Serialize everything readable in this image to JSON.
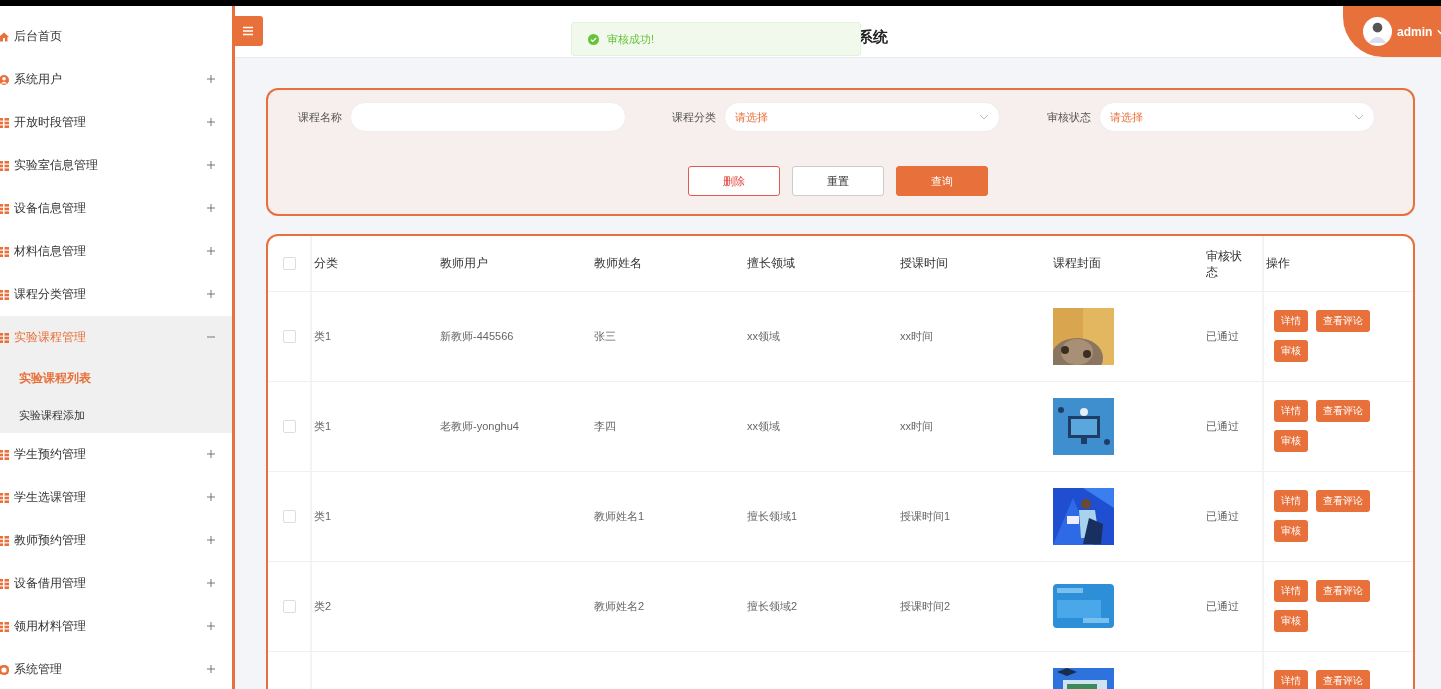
{
  "sidebar": {
    "items": [
      {
        "label": "后台首页",
        "kind": "home",
        "expandable": false,
        "expanded": false
      },
      {
        "label": "系统用户",
        "kind": "user",
        "expandable": true,
        "expanded": false
      },
      {
        "label": "开放时段管理",
        "kind": "grid",
        "expandable": true,
        "expanded": false
      },
      {
        "label": "实验室信息管理",
        "kind": "grid",
        "expandable": true,
        "expanded": false
      },
      {
        "label": "设备信息管理",
        "kind": "grid",
        "expandable": true,
        "expanded": false
      },
      {
        "label": "材料信息管理",
        "kind": "grid",
        "expandable": true,
        "expanded": false
      },
      {
        "label": "课程分类管理",
        "kind": "grid",
        "expandable": true,
        "expanded": false
      },
      {
        "label": "实验课程管理",
        "kind": "grid",
        "expandable": true,
        "expanded": true,
        "children": [
          {
            "label": "实验课程列表",
            "selected": true
          },
          {
            "label": "实验课程添加",
            "selected": false
          }
        ]
      },
      {
        "label": "学生预约管理",
        "kind": "grid",
        "expandable": true,
        "expanded": false
      },
      {
        "label": "学生选课管理",
        "kind": "grid",
        "expandable": true,
        "expanded": false
      },
      {
        "label": "教师预约管理",
        "kind": "grid",
        "expandable": true,
        "expanded": false
      },
      {
        "label": "设备借用管理",
        "kind": "grid",
        "expandable": true,
        "expanded": false
      },
      {
        "label": "领用材料管理",
        "kind": "grid",
        "expandable": true,
        "expanded": false
      },
      {
        "label": "系统管理",
        "kind": "gear",
        "expandable": true,
        "expanded": false
      }
    ]
  },
  "header": {
    "title": "系统",
    "user": "admin"
  },
  "toast": {
    "kind": "success",
    "message": "审核成功!"
  },
  "search": {
    "fields": [
      {
        "label": "课程名称",
        "kind": "input"
      },
      {
        "label": "课程分类",
        "kind": "select",
        "placeholder": "请选择"
      },
      {
        "label": "审核状态",
        "kind": "select",
        "placeholder": "请选择"
      }
    ],
    "buttons": [
      {
        "label": "删除",
        "kind": "danger"
      },
      {
        "label": "重置",
        "kind": "plain"
      },
      {
        "label": "查询",
        "kind": "primary"
      }
    ]
  },
  "table": {
    "all_checked": false,
    "columns": [
      "分类",
      "教师用户",
      "教师姓名",
      "擅长领域",
      "授课时间",
      "课程封面",
      "审核状态",
      "操作"
    ],
    "rows": [
      {
        "checked": false,
        "category": "类1",
        "teacher_user": "新教师-445566",
        "teacher_name": "张三",
        "field": "xx领域",
        "time": "xx时间",
        "cover": {
          "kind": "picture"
        },
        "status": "已通过",
        "actions": [
          "详情",
          "查看评论",
          "审核"
        ]
      },
      {
        "checked": false,
        "category": "类1",
        "teacher_user": "老教师-yonghu4",
        "teacher_name": "李四",
        "field": "xx领域",
        "time": "xx时间",
        "cover": {
          "kind": "picture"
        },
        "status": "已通过",
        "actions": [
          "详情",
          "查看评论",
          "审核"
        ]
      },
      {
        "checked": false,
        "category": "类1",
        "teacher_user": "",
        "teacher_name": "教师姓名1",
        "field": "擅长领域1",
        "time": "授课时间1",
        "cover": {
          "kind": "picture"
        },
        "status": "已通过",
        "actions": [
          "详情",
          "查看评论",
          "审核"
        ]
      },
      {
        "checked": false,
        "category": "类2",
        "teacher_user": "",
        "teacher_name": "教师姓名2",
        "field": "擅长领域2",
        "time": "授课时间2",
        "cover": {
          "kind": "picture"
        },
        "status": "已通过",
        "actions": [
          "详情",
          "查看评论",
          "审核"
        ]
      },
      {
        "cover": {
          "kind": "picture"
        },
        "actions": [
          "详情",
          "查看评论"
        ]
      }
    ]
  }
}
